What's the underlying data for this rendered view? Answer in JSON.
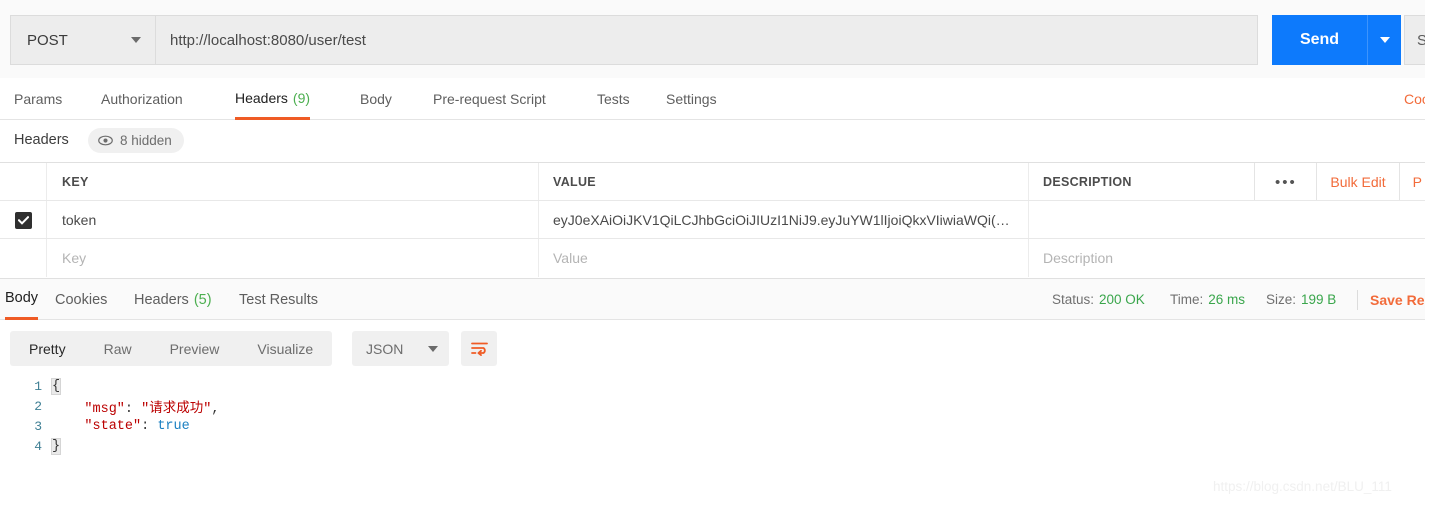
{
  "urlbar": {
    "method": "POST",
    "url": "http://localhost:8080/user/test",
    "send_label": "Send",
    "save_label": "Sa"
  },
  "request_tabs": [
    {
      "label": "Params",
      "count": "",
      "active": false
    },
    {
      "label": "Authorization",
      "count": "",
      "active": false
    },
    {
      "label": "Headers",
      "count": "(9)",
      "active": true
    },
    {
      "label": "Body",
      "count": "",
      "active": false
    },
    {
      "label": "Pre-request Script",
      "count": "",
      "active": false
    },
    {
      "label": "Tests",
      "count": "",
      "active": false
    },
    {
      "label": "Settings",
      "count": "",
      "active": false
    }
  ],
  "cookies_link": "Coo",
  "headers_panel": {
    "title": "Headers",
    "hidden_badge": "8 hidden",
    "columns": {
      "key": "KEY",
      "value": "VALUE",
      "description": "DESCRIPTION"
    },
    "actions": {
      "more": "•••",
      "bulk_edit": "Bulk Edit",
      "presets": "P"
    },
    "rows": [
      {
        "checked": true,
        "key": "token",
        "value": "eyJ0eXAiOiJKV1QiLCJhbGciOiJIUzI1NiJ9.eyJuYW1lIjoiQkxVIiwiaWQi(…",
        "description": ""
      }
    ],
    "placeholders": {
      "key": "Key",
      "value": "Value",
      "description": "Description"
    }
  },
  "response_tabs": [
    {
      "label": "Body",
      "count": "",
      "active": true
    },
    {
      "label": "Cookies",
      "count": "",
      "active": false
    },
    {
      "label": "Headers",
      "count": "(5)",
      "active": false
    },
    {
      "label": "Test Results",
      "count": "",
      "active": false
    }
  ],
  "response_meta": {
    "status_label": "Status:",
    "status_value": "200 OK",
    "time_label": "Time:",
    "time_value": "26 ms",
    "size_label": "Size:",
    "size_value": "199 B",
    "save_response": "Save Res"
  },
  "body_toolbar": {
    "views": [
      {
        "label": "Pretty",
        "active": true
      },
      {
        "label": "Raw",
        "active": false
      },
      {
        "label": "Preview",
        "active": false
      },
      {
        "label": "Visualize",
        "active": false
      }
    ],
    "format": "JSON"
  },
  "body_code": {
    "lines": [
      {
        "no": "1",
        "open_brace": "{"
      },
      {
        "no": "2",
        "key": "\"msg\"",
        "colon": ": ",
        "value": "\"请求成功\"",
        "tail": ","
      },
      {
        "no": "3",
        "key": "\"state\"",
        "colon": ": ",
        "value": "true",
        "tail": ""
      },
      {
        "no": "4",
        "close_brace": "}"
      }
    ]
  },
  "watermark": "https://blog.csdn.net/BLU_111",
  "colors": {
    "accent_orange": "#f26b3a",
    "send_blue": "#0d7afc",
    "green": "#4caf50"
  }
}
